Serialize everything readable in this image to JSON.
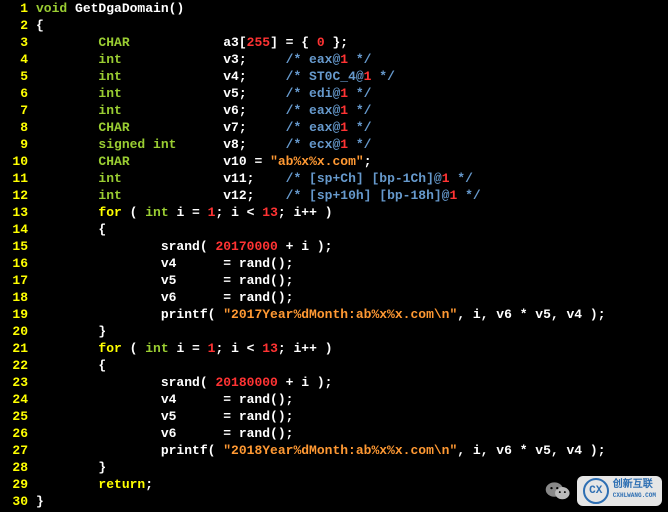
{
  "watermark": {
    "brand_initials": "CX",
    "brand_cn": "创新互联",
    "brand_py": "CXHLWANG.COM"
  },
  "code": {
    "lines": [
      {
        "n": "1",
        "seg": [
          [
            "kw-type",
            "void"
          ],
          [
            "ident",
            " GetDgaDomain"
          ],
          [
            "punct",
            "()"
          ]
        ]
      },
      {
        "n": "2",
        "seg": [
          [
            "punct",
            "{"
          ]
        ]
      },
      {
        "n": "3",
        "seg": [
          [
            "punct",
            "        "
          ],
          [
            "kw-type",
            "CHAR"
          ],
          [
            "punct",
            "            a3["
          ],
          [
            "num",
            "255"
          ],
          [
            "punct",
            "] = { "
          ],
          [
            "num",
            "0"
          ],
          [
            "punct",
            " };"
          ]
        ]
      },
      {
        "n": "4",
        "seg": [
          [
            "punct",
            "        "
          ],
          [
            "kw-type",
            "int"
          ],
          [
            "punct",
            "             v3;     "
          ],
          [
            "cmt",
            "/* eax@"
          ],
          [
            "num",
            "1"
          ],
          [
            "cmt",
            " */"
          ]
        ]
      },
      {
        "n": "5",
        "seg": [
          [
            "punct",
            "        "
          ],
          [
            "kw-type",
            "int"
          ],
          [
            "punct",
            "             v4;     "
          ],
          [
            "cmt",
            "/* ST0C_4@"
          ],
          [
            "num",
            "1"
          ],
          [
            "cmt",
            " */"
          ]
        ]
      },
      {
        "n": "6",
        "seg": [
          [
            "punct",
            "        "
          ],
          [
            "kw-type",
            "int"
          ],
          [
            "punct",
            "             v5;     "
          ],
          [
            "cmt",
            "/* edi@"
          ],
          [
            "num",
            "1"
          ],
          [
            "cmt",
            " */"
          ]
        ]
      },
      {
        "n": "7",
        "seg": [
          [
            "punct",
            "        "
          ],
          [
            "kw-type",
            "int"
          ],
          [
            "punct",
            "             v6;     "
          ],
          [
            "cmt",
            "/* eax@"
          ],
          [
            "num",
            "1"
          ],
          [
            "cmt",
            " */"
          ]
        ]
      },
      {
        "n": "8",
        "seg": [
          [
            "punct",
            "        "
          ],
          [
            "kw-type",
            "CHAR"
          ],
          [
            "punct",
            "            v7;     "
          ],
          [
            "cmt",
            "/* eax@"
          ],
          [
            "num",
            "1"
          ],
          [
            "cmt",
            " */"
          ]
        ]
      },
      {
        "n": "9",
        "seg": [
          [
            "punct",
            "        "
          ],
          [
            "kw-type",
            "signed int"
          ],
          [
            "punct",
            "      v8;     "
          ],
          [
            "cmt",
            "/* ecx@"
          ],
          [
            "num",
            "1"
          ],
          [
            "cmt",
            " */"
          ]
        ]
      },
      {
        "n": "10",
        "seg": [
          [
            "punct",
            "        "
          ],
          [
            "kw-type",
            "CHAR"
          ],
          [
            "punct",
            "            v10 = "
          ],
          [
            "str",
            "\"ab%x%x.com\""
          ],
          [
            "punct",
            ";"
          ]
        ]
      },
      {
        "n": "11",
        "seg": [
          [
            "punct",
            "        "
          ],
          [
            "kw-type",
            "int"
          ],
          [
            "punct",
            "             v11;    "
          ],
          [
            "cmt",
            "/* [sp+Ch] [bp-1Ch]@"
          ],
          [
            "num",
            "1"
          ],
          [
            "cmt",
            " */"
          ]
        ]
      },
      {
        "n": "12",
        "seg": [
          [
            "punct",
            "        "
          ],
          [
            "kw-type",
            "int"
          ],
          [
            "punct",
            "             v12;    "
          ],
          [
            "cmt",
            "/* [sp+10h] [bp-18h]@"
          ],
          [
            "num",
            "1"
          ],
          [
            "cmt",
            " */"
          ]
        ]
      },
      {
        "n": "13",
        "seg": [
          [
            "punct",
            "        "
          ],
          [
            "kw-flow",
            "for"
          ],
          [
            "punct",
            " ( "
          ],
          [
            "kw-type",
            "int"
          ],
          [
            "punct",
            " i = "
          ],
          [
            "num",
            "1"
          ],
          [
            "punct",
            "; i < "
          ],
          [
            "num",
            "13"
          ],
          [
            "punct",
            "; i++ )"
          ]
        ]
      },
      {
        "n": "14",
        "seg": [
          [
            "punct",
            "        {"
          ]
        ]
      },
      {
        "n": "15",
        "seg": [
          [
            "punct",
            "                srand( "
          ],
          [
            "num",
            "20170000"
          ],
          [
            "punct",
            " + i );"
          ]
        ]
      },
      {
        "n": "16",
        "seg": [
          [
            "punct",
            "                v4      = rand();"
          ]
        ]
      },
      {
        "n": "17",
        "seg": [
          [
            "punct",
            "                v5      = rand();"
          ]
        ]
      },
      {
        "n": "18",
        "seg": [
          [
            "punct",
            "                v6      = rand();"
          ]
        ]
      },
      {
        "n": "19",
        "seg": [
          [
            "punct",
            "                printf( "
          ],
          [
            "str",
            "\"2017Year%dMonth:ab%x%x.com\\n\""
          ],
          [
            "punct",
            ", i, v6 * v5, v4 );"
          ]
        ]
      },
      {
        "n": "20",
        "seg": [
          [
            "punct",
            "        }"
          ]
        ]
      },
      {
        "n": "21",
        "seg": [
          [
            "punct",
            "        "
          ],
          [
            "kw-flow",
            "for"
          ],
          [
            "punct",
            " ( "
          ],
          [
            "kw-type",
            "int"
          ],
          [
            "punct",
            " i = "
          ],
          [
            "num",
            "1"
          ],
          [
            "punct",
            "; i < "
          ],
          [
            "num",
            "13"
          ],
          [
            "punct",
            "; i++ )"
          ]
        ]
      },
      {
        "n": "22",
        "seg": [
          [
            "punct",
            "        {"
          ]
        ]
      },
      {
        "n": "23",
        "seg": [
          [
            "punct",
            "                srand( "
          ],
          [
            "num",
            "20180000"
          ],
          [
            "punct",
            " + i );"
          ]
        ]
      },
      {
        "n": "24",
        "seg": [
          [
            "punct",
            "                v4      = rand();"
          ]
        ]
      },
      {
        "n": "25",
        "seg": [
          [
            "punct",
            "                v5      = rand();"
          ]
        ]
      },
      {
        "n": "26",
        "seg": [
          [
            "punct",
            "                v6      = rand();"
          ]
        ]
      },
      {
        "n": "27",
        "seg": [
          [
            "punct",
            "                printf( "
          ],
          [
            "str",
            "\"2018Year%dMonth:ab%x%x.com\\n\""
          ],
          [
            "punct",
            ", i, v6 * v5, v4 );"
          ]
        ]
      },
      {
        "n": "28",
        "seg": [
          [
            "punct",
            "        }"
          ]
        ]
      },
      {
        "n": "29",
        "seg": [
          [
            "punct",
            "        "
          ],
          [
            "kw-flow",
            "return"
          ],
          [
            "punct",
            ";"
          ]
        ]
      },
      {
        "n": "30",
        "seg": [
          [
            "punct",
            "}"
          ]
        ]
      }
    ]
  }
}
